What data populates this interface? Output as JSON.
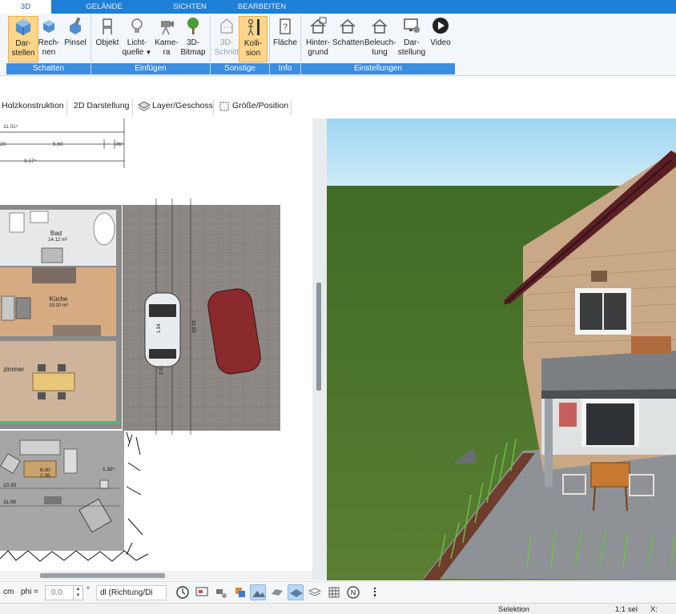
{
  "ribbon_tabs": [
    "3D",
    "GELÄNDE",
    "SICHTEN",
    "BEARBEITEN"
  ],
  "ribbon_buttons": [
    {
      "l1": "Dar-",
      "l2": "stellen",
      "icon": "cube-display-icon"
    },
    {
      "l1": "Rech-",
      "l2": "nen",
      "icon": "cube-render-icon"
    },
    {
      "l1": "Pinsel",
      "l2": "",
      "icon": "brush-cube-icon"
    },
    {
      "l1": "Objekt",
      "l2": "",
      "icon": "chair-icon"
    },
    {
      "l1": "Licht-",
      "l2": "quelle",
      "icon": "lightbulb-icon"
    },
    {
      "l1": "Kame-",
      "l2": "ra",
      "icon": "camera-icon"
    },
    {
      "l1": "3D-",
      "l2": "Bitmap",
      "icon": "tree-icon"
    },
    {
      "l1": "3D-",
      "l2": "Schnitt",
      "icon": "section-cut-icon"
    },
    {
      "l1": "Kolli-",
      "l2": "sion",
      "icon": "person-collision-icon"
    },
    {
      "l1": "Fläche",
      "l2": "",
      "icon": "area-question-icon"
    },
    {
      "l1": "Hinter-",
      "l2": "grund",
      "icon": "house-background-icon"
    },
    {
      "l1": "Schatten",
      "l2": "",
      "icon": "house-shadow-icon"
    },
    {
      "l1": "Beleuch-",
      "l2": "tung",
      "icon": "house-light-icon"
    },
    {
      "l1": "Dar-",
      "l2": "stellung",
      "icon": "monitor-gear-icon"
    },
    {
      "l1": "Video",
      "l2": "",
      "icon": "play-icon"
    }
  ],
  "ribbon_groups": [
    "Schatten",
    "Einfügen",
    "Sonstige",
    "Info",
    "Einstellungen"
  ],
  "toolbar2": [
    "Holzkonstruktion",
    "2D Darstellung",
    "Layer/Geschoss",
    "Größe/Position"
  ],
  "plan": {
    "dims": [
      "11.01⁵",
      "20",
      "5.60",
      "36⁵",
      "9.17⁵"
    ],
    "rooms": [
      {
        "name": "Bad",
        "area": "14.12 m²"
      },
      {
        "name": "Küche",
        "area": "19.20 m²"
      },
      {
        "name": "zimmer",
        "area": ""
      }
    ],
    "labels": [
      "6.00",
      "2.35",
      "10.35",
      "11.08",
      "1.32⁵",
      "11.03",
      "2.01",
      "1.94"
    ]
  },
  "bottombar": {
    "unit": "cm",
    "phi_label": "phi =",
    "phi_value": "0.0",
    "degree": "°",
    "combo": "dl (Richtung/Di"
  },
  "statusbar": {
    "mode": "Selektion",
    "scale": "1:1 sel",
    "x_label": "X:"
  },
  "colors": {
    "ribbon_blue": "#1e7fd6",
    "group_blue": "#3a8de0",
    "selected": "#fbd58a"
  }
}
